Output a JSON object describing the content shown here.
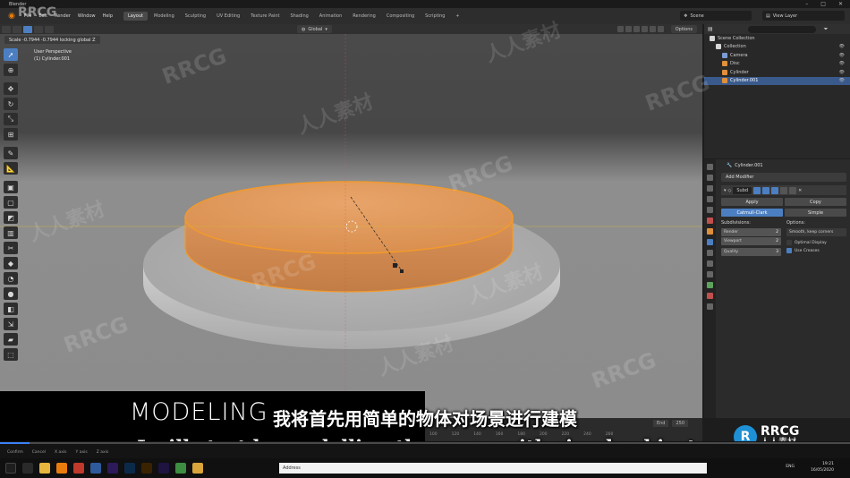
{
  "window": {
    "title": "Blender"
  },
  "menu": [
    "File",
    "Edit",
    "Render",
    "Window",
    "Help"
  ],
  "workspaces": [
    "Layout",
    "Modeling",
    "Sculpting",
    "UV Editing",
    "Texture Paint",
    "Shading",
    "Animation",
    "Rendering",
    "Compositing",
    "Scripting",
    "+"
  ],
  "scene": {
    "label": "Scene",
    "view_layer": "View Layer"
  },
  "viewport_header": {
    "orientation": "Global",
    "options": "Options"
  },
  "viewport": {
    "status": "Scale -0.7944 -0.7944 locking global Z",
    "view": "User Perspective",
    "object": "(1) Cylinder.001"
  },
  "outliner": {
    "rows": [
      {
        "label": "Scene Collection",
        "indent": 0
      },
      {
        "label": "Collection",
        "indent": 1
      },
      {
        "label": "Camera",
        "indent": 2
      },
      {
        "label": "Disc",
        "indent": 2
      },
      {
        "label": "Cylinder",
        "indent": 2
      },
      {
        "label": "Cylinder.001",
        "indent": 2,
        "selected": true
      }
    ]
  },
  "properties": {
    "object_name": "Cylinder.001",
    "add_modifier": "Add Modifier",
    "modifier_name": "Subd",
    "apply": "Apply",
    "copy": "Copy",
    "catmull": "Catmull-Clark",
    "simple": "Simple",
    "subdivisions_label": "Subdivisions:",
    "options_label": "Options:",
    "render_label": "Render",
    "render_val": "2",
    "viewport_label": "Viewport",
    "viewport_val": "2",
    "quality_label": "Quality",
    "quality_val": "3",
    "uv_smooth": "Smooth, keep corners",
    "optimal_display": "Optimal Display",
    "use_creases": "Use Creases"
  },
  "timeline": {
    "end_label": "End",
    "end_val": "250",
    "ticks": [
      "100",
      "120",
      "140",
      "160",
      "180",
      "200",
      "220",
      "240",
      "260"
    ]
  },
  "captions": {
    "modeling": "MODELING",
    "subtitle_cn": "我将首先用简单的物体对场景进行建模",
    "subtitle_en": "I will start by modelling the scene with simple objects."
  },
  "player": {
    "progress": 0.035,
    "items": [
      "Confirm",
      "Cancel",
      "X axis",
      "Y axis",
      "Z axis"
    ]
  },
  "taskbar": {
    "address_label": "Address",
    "lang": "ENG",
    "time": "19:21",
    "date": "16/05/2020"
  },
  "watermarks": {
    "rrcg": "RRCG",
    "cn": "人人素材",
    "brand_top": "RRCG",
    "brand_bottom": "人人素材"
  },
  "colors": {
    "accent": "#4c7fc2",
    "selection": "#f39a2b",
    "blender_orange": "#e87d0d"
  }
}
